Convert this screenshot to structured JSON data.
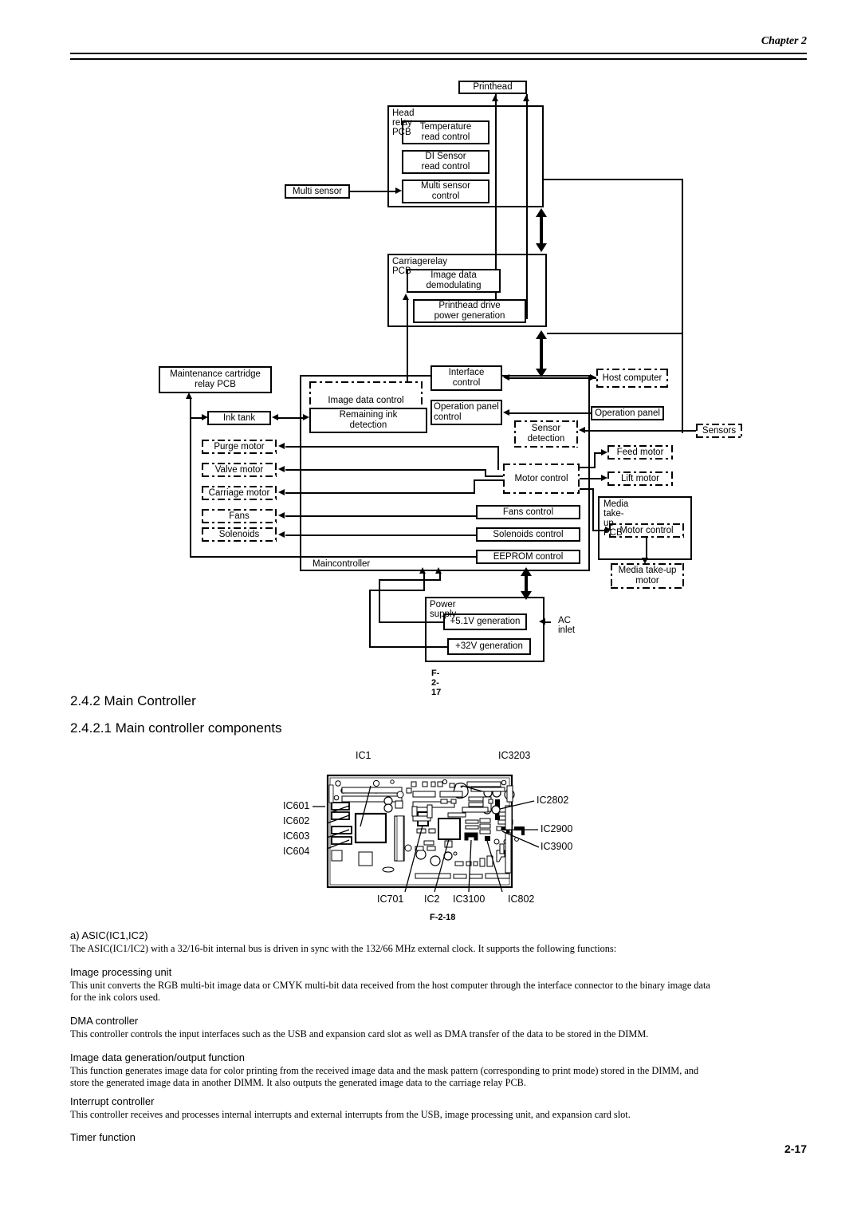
{
  "header": {
    "chapter": "Chapter 2"
  },
  "footer": {
    "page": "2-17"
  },
  "figure_block_diagram": {
    "caption": "F-2-17",
    "blocks": {
      "printhead": "Printhead",
      "head_relay_pcb": "Head relay PCB",
      "temperature_read_control": "Temperature\nread control",
      "temperature_read_control_l1": "Temperature",
      "temperature_read_control_l2": "read control",
      "di_sensor_read_control_l1": "DI Sensor",
      "di_sensor_read_control_l2": "read control",
      "multi_sensor_control_l1": "Multi sensor",
      "multi_sensor_control_l2": "control",
      "multi_sensor": "Multi sensor",
      "carriage_relay_pcb": "Carriagerelay PCB",
      "image_data_demodulating_l1": "Image data",
      "image_data_demodulating_l2": "demodulating",
      "printhead_drive_l1": "Printhead drive",
      "printhead_drive_l2": "power generation",
      "maintenance_cartridge_l1": "Maintenance cartridge",
      "maintenance_cartridge_l2": "relay PCB",
      "ink_tank": "Ink tank",
      "purge_motor": "Purge motor",
      "valve_motor": "Valve motor",
      "carriage_motor": "Carriage motor",
      "fans": "Fans",
      "solenoids": "Solenoids",
      "main_controller": "Maincontroller",
      "image_data_control": "Image data control",
      "remaining_ink_l1": "Remaining ink",
      "remaining_ink_l2": "detection",
      "interface_control_l1": "Interface",
      "interface_control_l2": "control",
      "operation_panel_control_l1": "Operation panel",
      "operation_panel_control_l2": "control",
      "host_computer": "Host computer",
      "operation_panel": "Operation panel",
      "sensor_detection_l1": "Sensor",
      "sensor_detection_l2": "detection",
      "sensors": "Sensors",
      "motor_control": "Motor control",
      "feed_motor": "Feed  motor",
      "lift_motor": "Lift motor",
      "fans_control": "Fans control",
      "solenoids_control": "Solenoids control",
      "eeprom_control": "EEPROM control",
      "media_takeup_pcb": "Media take-up PCB",
      "media_motor_control": "Motor control",
      "media_takeup_motor_l1": "Media take-up",
      "media_takeup_motor_l2": "motor",
      "power_supply": "Power supply",
      "v51_generation": "+5.1V generation",
      "v32_generation": "+32V generation",
      "ac_inlet": "AC inlet"
    }
  },
  "sections": {
    "s242": "2.4.2 Main Controller",
    "s2421": "2.4.2.1 Main controller components"
  },
  "figure_pcb": {
    "caption": "F-2-18",
    "labels": {
      "ic1": "IC1",
      "ic3203": "IC3203",
      "ic601": "IC601",
      "ic602": "IC602",
      "ic603": "IC603",
      "ic604": "IC604",
      "ic2802": "IC2802",
      "ic2900": "IC2900",
      "ic3900": "IC3900",
      "ic701": "IC701",
      "ic2": "IC2",
      "ic3100": "IC3100",
      "ic802": "IC802"
    }
  },
  "body": {
    "asic_heading": "a) ASIC(IC1,IC2)",
    "asic_text": "The ASIC(IC1/IC2) with a 32/16-bit internal bus is driven in sync with the 132/66 MHz external clock. It supports the following functions:",
    "image_processing_heading": "Image processing unit",
    "image_processing_text_l1": "This unit converts the RGB multi-bit image data or CMYK multi-bit data received from the host computer through the interface connector to the binary image data",
    "image_processing_text_l2": "for the ink colors used.",
    "dma_heading": "DMA controller",
    "dma_text": "This controller controls the input interfaces such as the USB and expansion card slot as well as DMA transfer of the data to be stored in the DIMM.",
    "imagegen_heading": "Image data generation/output function",
    "imagegen_text_l1": "This function generates image data for color printing from the received image data and the mask pattern (corresponding to print mode) stored in the DIMM, and",
    "imagegen_text_l2": "store the generated image data in another DIMM. It also outputs the generated image data to the carriage relay PCB.",
    "interrupt_heading": "Interrupt controller",
    "interrupt_text": "This controller receives and processes internal interrupts and external interrupts from the USB, image processing unit, and expansion card slot.",
    "timer_heading": "Timer function"
  }
}
